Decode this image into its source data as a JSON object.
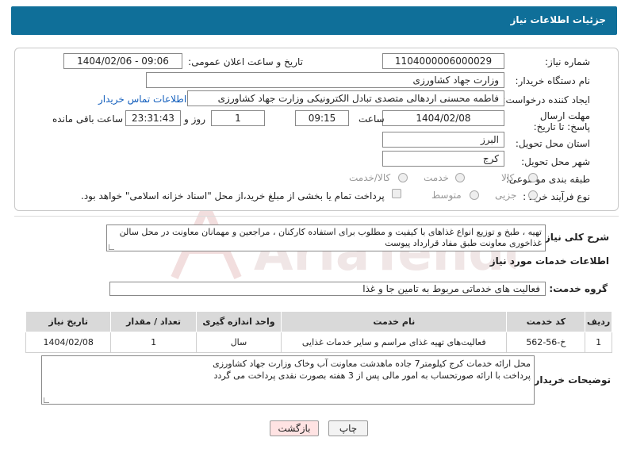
{
  "header": {
    "title": "جزئیات اطلاعات نیاز"
  },
  "labels": {
    "need_number": "شماره نیاز:",
    "announce_datetime": "تاریخ و ساعت اعلان عمومی:",
    "buyer_org": "نام دستگاه خریدار:",
    "requester": "ایجاد کننده درخواست:",
    "deadline": "مهلت ارسال پاسخ: تا تاریخ:",
    "time": "ساعت",
    "day_and": "روز و",
    "remaining": "ساعت باقی مانده",
    "province": "استان محل تحویل:",
    "city": "شهر محل تحویل:",
    "category": "طبقه بندی موضوعی:",
    "process_type": "نوع فرآیند خرید :",
    "general_desc": "شرح کلی نیاز:",
    "services_info": "اطلاعات خدمات مورد نیاز",
    "service_group": "گروه خدمت:",
    "buyer_notes": "توضیحات خریدار:"
  },
  "fields": {
    "need_number": "1104000006000029",
    "announce_datetime": "1404/02/06 - 09:06",
    "buyer_org": "وزارت جهاد کشاورزی",
    "requester": "فاطمه محسنی اردهالی متصدی تبادل الکترونیکی وزارت جهاد کشاورزی",
    "contact_link": "اطلاعات تماس خریدار",
    "deadline_date": "1404/02/08",
    "deadline_time": "09:15",
    "days": "1",
    "remaining_time": "23:31:43",
    "province": "البرز",
    "city": "کرج",
    "general_desc": "تهیه ، طبخ و توزیع انواع غذاهای با کیفیت و  مطلوب برای  استفاده کارکنان  ، مراجعین و مهمانان معاونت در محل سالن غذاخوری معاونت طبق مفاد قرارداد پیوست",
    "service_group": "فعالیت های خدماتی مربوط به تامین جا و غذا",
    "buyer_notes_line1": "محل ارائه خدمات کرج کیلومتر7 جاده ماهدشت معاونت آب وخاک وزارت جهاد کشاورزی",
    "buyer_notes_line2": "پرداخت با ارائه صورتحساب به امور مالی پس از 3 هفته بصورت نقدی پرداخت می گردد"
  },
  "category_options": [
    "کالا",
    "خدمت",
    "کالا/خدمت"
  ],
  "process_options": [
    "جزیی",
    "متوسط"
  ],
  "payment_note": "پرداخت تمام یا بخشی از مبلغ خرید،از محل \"اسناد خزانه اسلامی\" خواهد بود.",
  "table": {
    "headers": [
      "ردیف",
      "کد خدمت",
      "نام خدمت",
      "واحد اندازه گیری",
      "تعداد / مقدار",
      "تاریخ نیاز"
    ],
    "rows": [
      [
        "1",
        "خ-56-562",
        "فعالیت‌های تهیه غذای مراسم و سایر خدمات غذایی",
        "سال",
        "1",
        "1404/02/08"
      ]
    ]
  },
  "buttons": {
    "print": "چاپ",
    "back": "بازگشت"
  },
  "watermark": {
    "text": "AriaTender.net"
  }
}
